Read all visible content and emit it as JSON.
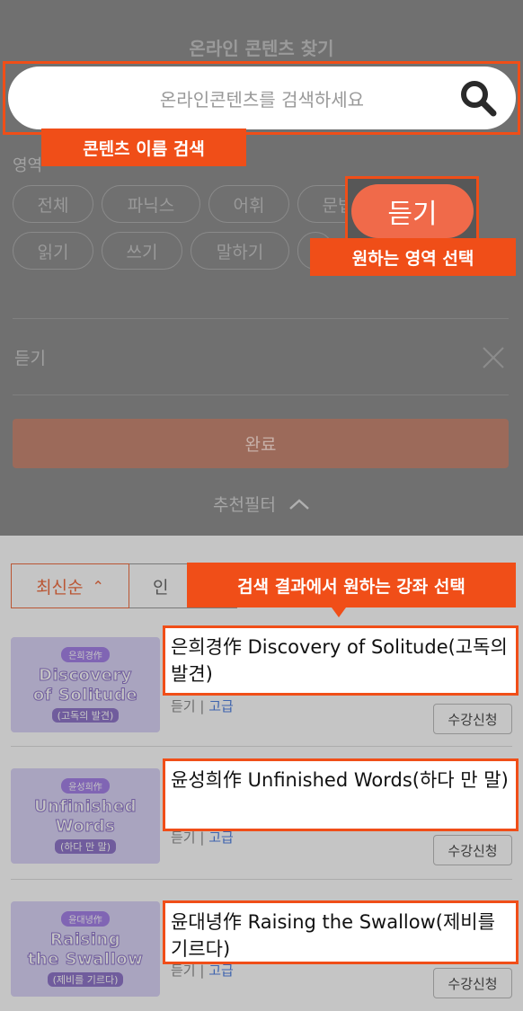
{
  "filter_panel": {
    "title": "온라인 콘텐츠 찾기",
    "search_placeholder": "온라인콘텐츠를 검색하세요",
    "area_label": "영역",
    "chips": [
      "전체",
      "파닉스",
      "어휘",
      "문법",
      "읽기",
      "쓰기",
      "말하기"
    ],
    "selected_label": "듣기",
    "done_label": "완료",
    "recommend_filter_label": "추천필터"
  },
  "annotations": {
    "search_callout": "콘텐츠 이름 검색",
    "area_button": "듣기",
    "area_callout": "원하는 영역 선택",
    "results_callout": "검색 결과에서 원하는 강좌 선택"
  },
  "sort": {
    "latest_label": "최신순",
    "second_label": "인"
  },
  "courses": [
    {
      "title": "은희경作 Discovery of Solitude(고독의 발견)",
      "thumb_tag": "은희경作",
      "thumb_line1": "Discovery",
      "thumb_line2": "of Solitude",
      "thumb_sub": "(고독의 발견)",
      "area": "듣기",
      "level": "고급",
      "enroll_label": "수강신청"
    },
    {
      "title": "윤성희作 Unfinished Words(하다 만 말)",
      "thumb_tag": "윤성희作",
      "thumb_line1": "Unfinished",
      "thumb_line2": "Words",
      "thumb_sub": "(하다 만 말)",
      "area": "듣기",
      "level": "고급",
      "enroll_label": "수강신청"
    },
    {
      "title": "윤대녕作 Raising the Swallow(제비를 기르다)",
      "thumb_tag": "윤대녕作",
      "thumb_line1": "Raising",
      "thumb_line2": "the Swallow",
      "thumb_sub": "(제비를 기르다)",
      "area": "듣기",
      "level": "고급",
      "enroll_label": "수강신청"
    }
  ],
  "icons": {
    "search": "search-icon",
    "close": "close-icon",
    "chevron": "chevron-up-icon"
  },
  "colors": {
    "accent": "#f04e18",
    "button_orange": "#f06a4a",
    "overlay": "#707070"
  }
}
